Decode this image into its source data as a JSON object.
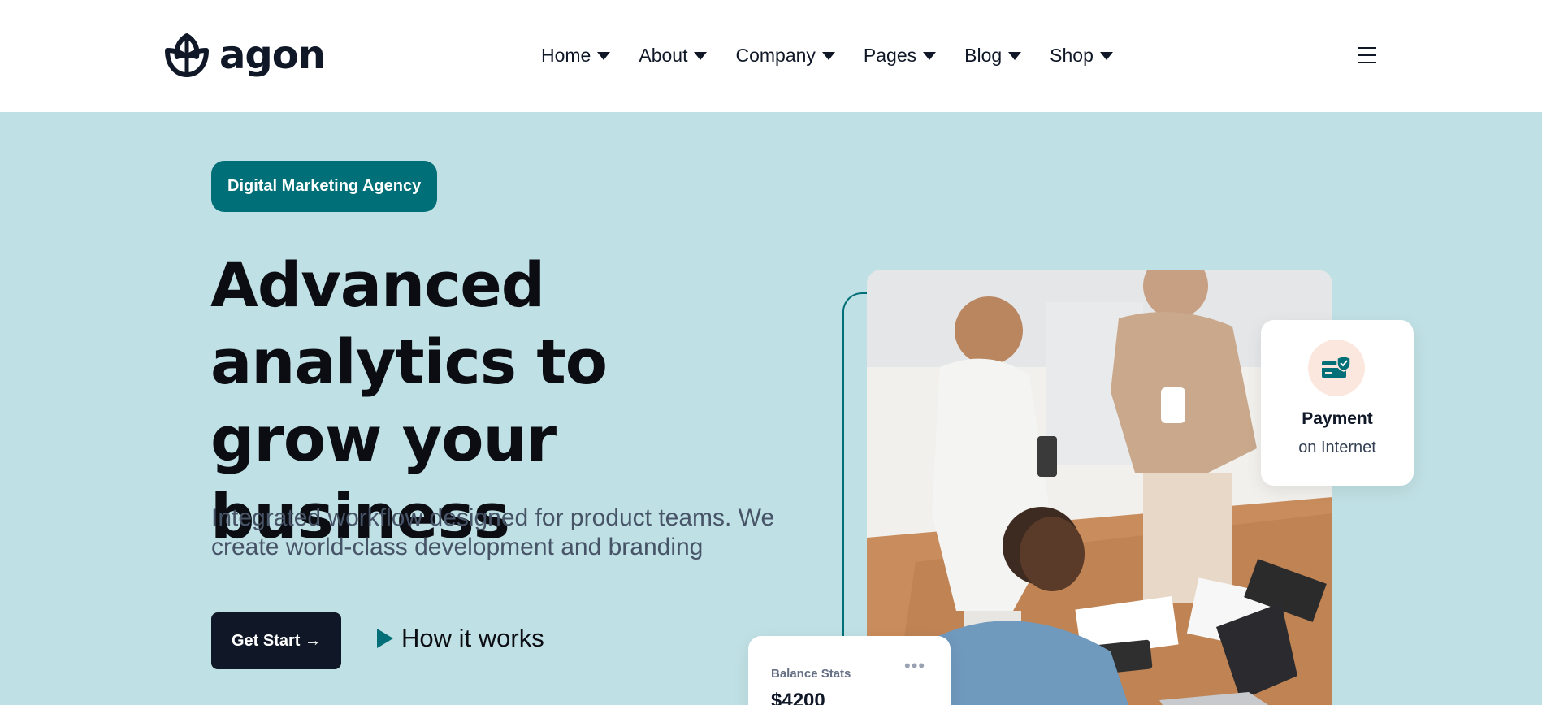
{
  "brand": {
    "name": "agon"
  },
  "nav": {
    "items": [
      {
        "label": "Home"
      },
      {
        "label": "About"
      },
      {
        "label": "Company"
      },
      {
        "label": "Pages"
      },
      {
        "label": "Blog"
      },
      {
        "label": "Shop"
      }
    ]
  },
  "hero": {
    "badge": "Digital Marketing Agency",
    "title": "Advanced analytics to grow your business",
    "description": "Integrated workflow designed for product teams. We create world-class development and branding",
    "cta_label": "Get Start →",
    "secondary_label": "How it works"
  },
  "payment_card": {
    "title": "Payment",
    "subtitle": "on Internet"
  },
  "balance_card": {
    "label": "Balance Stats",
    "value": "$4200",
    "more": "•••"
  },
  "colors": {
    "accent": "#006f77",
    "hero_bg": "#bfe0e4",
    "dark": "#101828",
    "payment_icon_bg": "#fbe7dd"
  },
  "icons": [
    "leaf-logo-icon",
    "chevron-down-icon",
    "menu-icon",
    "play-icon",
    "payment-card-icon",
    "more-dots-icon"
  ]
}
